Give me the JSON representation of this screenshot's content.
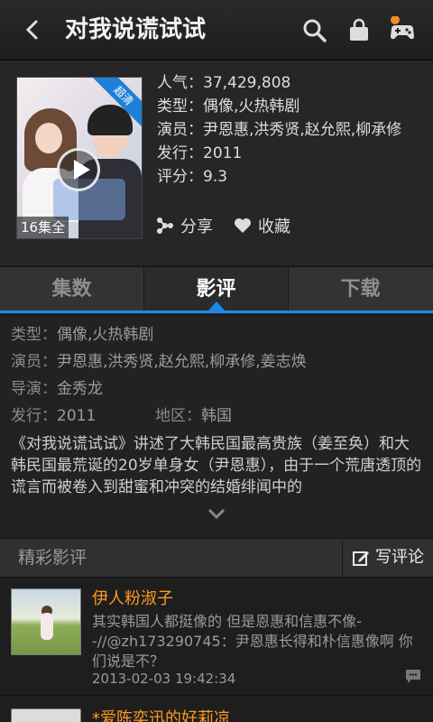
{
  "header": {
    "title": "对我说谎试试",
    "icons": [
      "back-icon",
      "search-icon",
      "bag-icon",
      "game-icon"
    ],
    "notification_color": "#f28c28"
  },
  "show": {
    "badge": "超清",
    "episodes": "16集全",
    "popularity": "人气：37,429,808",
    "genre": "类型：偶像,火热韩剧",
    "cast": "演员：尹恩惠,洪秀贤,赵允熙,柳承修",
    "release": "发行：2011",
    "rating": "评分：9.3",
    "share_label": "分享",
    "favorite_label": "收藏"
  },
  "tabs": [
    {
      "label": "集数",
      "active": false
    },
    {
      "label": "影评",
      "active": true
    },
    {
      "label": "下载",
      "active": false
    }
  ],
  "detail": {
    "genre_label": "类型：",
    "genre_value": "偶像,火热韩剧",
    "cast_label": "演员：",
    "cast_value": "尹恩惠,洪秀贤,赵允熙,柳承修,姜志焕",
    "director_label": "导演：",
    "director_value": "金秀龙",
    "release_label": "发行：",
    "release_value": "2011",
    "region_label": "地区：",
    "region_value": "韩国",
    "synopsis": "《对我说谎试试》讲述了大韩民国最高贵族（姜至奂）和大韩民国最荒诞的20岁单身女（尹恩惠），由于一个荒唐透顶的谎言而被卷入到甜蜜和冲突的结婚绯闻中的"
  },
  "reviews_section": {
    "title": "精彩影评",
    "write_label": "写评论"
  },
  "reviews": [
    {
      "name": "伊人粉淑子",
      "text": "其实韩国人都挺像的 但是恩惠和信惠不像- -//@zh173290745：尹恩惠长得和朴信惠像啊 你们说是不？",
      "time": "2013-02-03 19:42:34"
    },
    {
      "name": "*爱陈奕迅的好莉凉"
    }
  ],
  "colors": {
    "accent": "#1e88e5",
    "username": "#ff9a1f",
    "background": "#1c1c1c"
  }
}
